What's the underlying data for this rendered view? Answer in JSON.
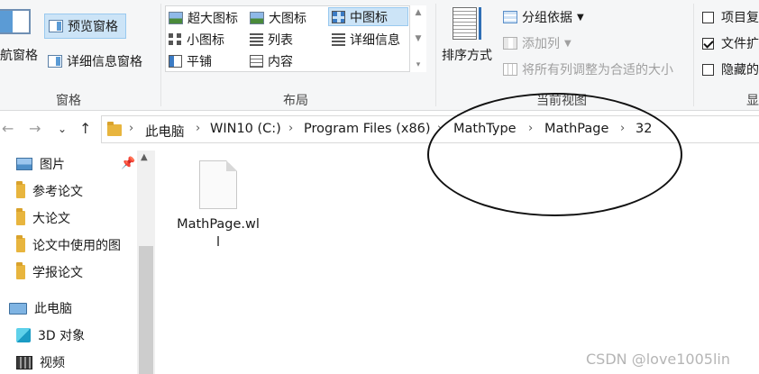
{
  "ribbon": {
    "pane_group": {
      "nav_pane_label": "航窗格",
      "preview_pane_label": "预览窗格",
      "details_pane_label": "详细信息窗格",
      "group_label": "窗格"
    },
    "layout_group": {
      "items": [
        {
          "label": "超大图标",
          "icon": "extra-large-icons-icon"
        },
        {
          "label": "大图标",
          "icon": "large-icons-icon"
        },
        {
          "label": "中图标",
          "icon": "medium-icons-icon",
          "selected": true
        },
        {
          "label": "小图标",
          "icon": "small-icons-icon"
        },
        {
          "label": "列表",
          "icon": "list-icon"
        },
        {
          "label": "详细信息",
          "icon": "details-icon"
        },
        {
          "label": "平铺",
          "icon": "tiles-icon"
        },
        {
          "label": "内容",
          "icon": "content-icon"
        }
      ],
      "group_label": "布局"
    },
    "current_view_group": {
      "sort_label": "排序方式",
      "group_by_label": "分组依据",
      "add_column_label": "添加列",
      "size_all_columns_label": "将所有列调整为合适的大小",
      "group_label": "当前视图"
    },
    "show_hide_group": {
      "item_checkboxes_label": "项目复",
      "file_extensions_label": "文件扩",
      "hidden_items_label": "隐藏的",
      "group_label": "显",
      "file_extensions_checked": true,
      "item_checkboxes_checked": false,
      "hidden_items_checked": false
    }
  },
  "address_bar": {
    "breadcrumbs": [
      "此电脑",
      "WIN10 (C:)",
      "Program Files (x86)",
      "MathType",
      "MathPage",
      "32"
    ]
  },
  "nav_pane": {
    "items": [
      {
        "label": "图片",
        "icon": "pictures-icon"
      },
      {
        "label": "参考论文",
        "icon": "folder-icon"
      },
      {
        "label": "大论文",
        "icon": "folder-icon"
      },
      {
        "label": "论文中使用的图",
        "icon": "folder-icon"
      },
      {
        "label": "学报论文",
        "icon": "folder-icon"
      },
      {
        "label": "此电脑",
        "icon": "this-pc-icon"
      },
      {
        "label": "3D 对象",
        "icon": "3d-objects-icon"
      },
      {
        "label": "视频",
        "icon": "videos-icon"
      }
    ]
  },
  "content": {
    "files": [
      {
        "name": "MathPage.wll",
        "icon": "file-icon"
      }
    ]
  },
  "watermark": "CSDN @love1005lin",
  "colors": {
    "selected_bg": "#cce4f7",
    "selected_border": "#99c9ef",
    "folder": "#e8b53e",
    "ribbon_bg": "#f5f6f7"
  }
}
